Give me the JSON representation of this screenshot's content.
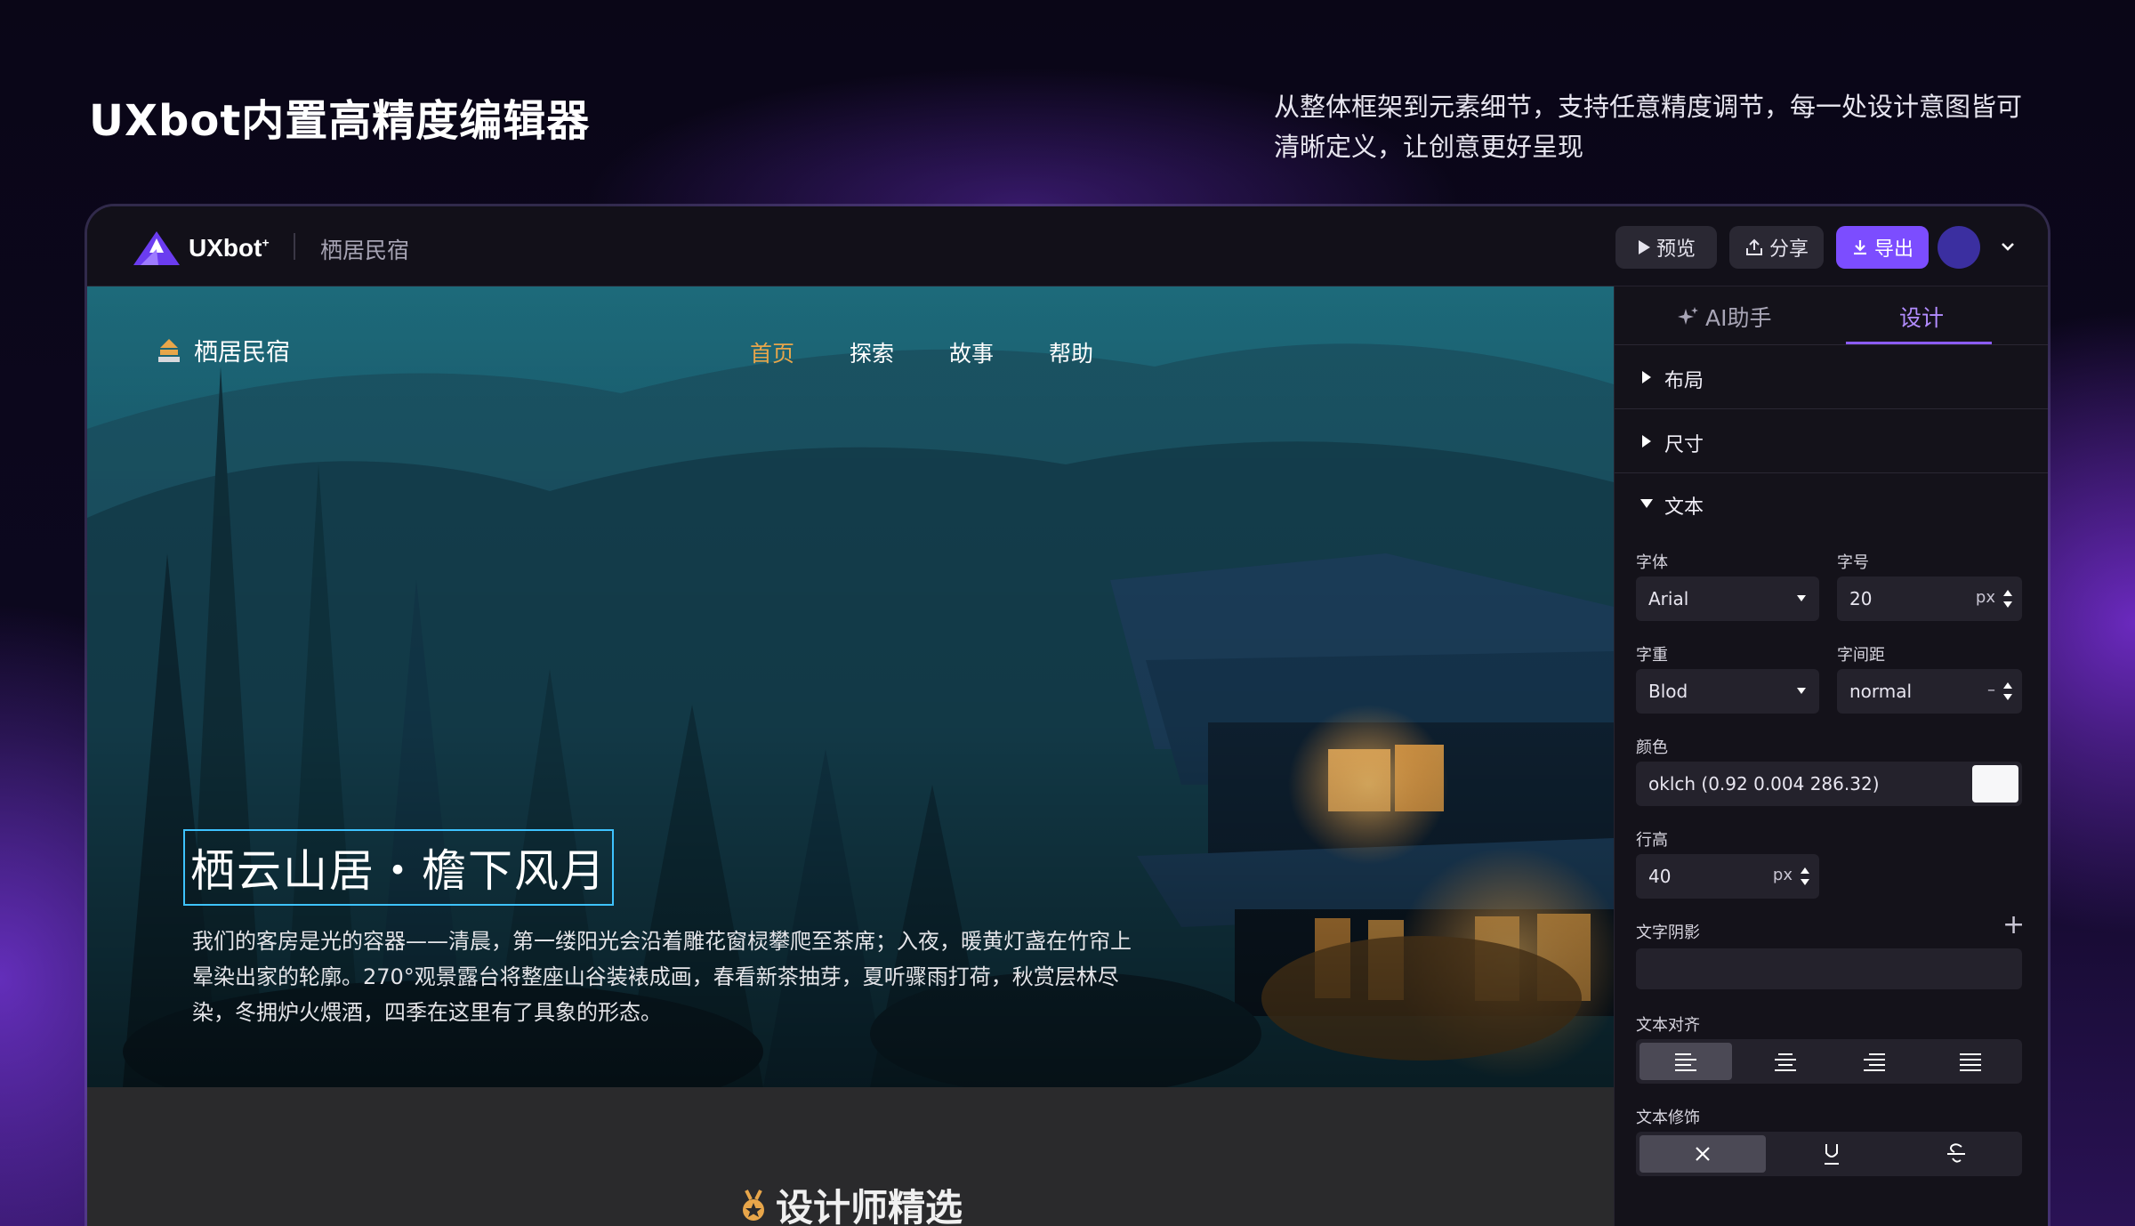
{
  "marketing": {
    "headline": "UXbot内置高精度编辑器",
    "tagline": "从整体框架到元素细节，支持任意精度调节，每一处设计意图皆可清晰定义，让创意更好呈现"
  },
  "topbar": {
    "brand": "UXbot",
    "brand_sup": "+",
    "project": "栖居民宿",
    "preview": "预览",
    "share": "分享",
    "export": "导出"
  },
  "site": {
    "logo": "栖居民宿",
    "nav": [
      "首页",
      "探索",
      "故事",
      "帮助"
    ],
    "hero_title": "栖云山居・檐下风月",
    "hero_desc": "我们的客房是光的容器——清晨，第一缕阳光会沿着雕花窗棂攀爬至茶席；入夜，暖黄灯盏在竹帘上晕染出家的轮廓。270°观景露台将整座山谷装裱成画，春看新茶抽芽，夏听骤雨打荷，秋赏层林尽染，冬拥炉火煨酒，四季在这里有了具象的形态。",
    "section_title": "设计师精选"
  },
  "panel": {
    "tab_ai": "AI助手",
    "tab_design": "设计",
    "sec_layout": "布局",
    "sec_size": "尺寸",
    "sec_text": "文本",
    "font_label": "字体",
    "font_value": "Arial",
    "size_label": "字号",
    "size_value": "20",
    "size_unit": "px",
    "weight_label": "字重",
    "weight_value": "Blod",
    "spacing_label": "字间距",
    "spacing_value": "normal",
    "spacing_unit": "–",
    "color_label": "颜色",
    "color_value": "oklch  (0.92 0.004 286.32)",
    "swatch_color": "#f7f7f9",
    "lineheight_label": "行高",
    "lineheight_value": "40",
    "lineheight_unit": "px",
    "shadow_label": "文字阴影",
    "align_label": "文本对齐",
    "decor_label": "文本修饰"
  },
  "colors": {
    "accent": "#7c4dff",
    "nav_active": "#e8a64a",
    "selection": "#3ec3ff"
  }
}
